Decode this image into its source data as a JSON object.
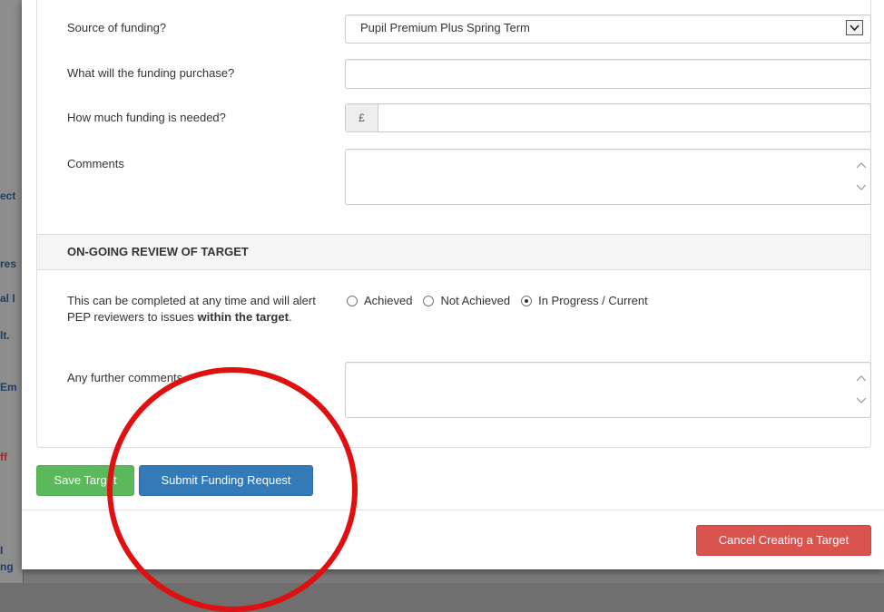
{
  "background": {
    "sidebar_fragments": [
      "ect",
      "res",
      "al I",
      "lt.",
      "Em",
      "ff",
      "I",
      "ng"
    ]
  },
  "form": {
    "source_of_funding": {
      "label": "Source of funding?",
      "selected": "Pupil Premium Plus Spring Term"
    },
    "funding_purchase": {
      "label": "What will the funding purchase?",
      "value": ""
    },
    "funding_needed": {
      "label": "How much funding is needed?",
      "currency_symbol": "£",
      "value": ""
    },
    "comments": {
      "label": "Comments",
      "value": ""
    }
  },
  "review": {
    "header": "ON-GOING REVIEW OF TARGET",
    "description_prefix": "This can be completed at any time and will alert PEP reviewers to issues ",
    "description_bold": "within the target",
    "description_suffix": ".",
    "options": [
      {
        "label": "Achieved",
        "checked": false
      },
      {
        "label": "Not Achieved",
        "checked": false
      },
      {
        "label": "In Progress / Current",
        "checked": true
      }
    ],
    "further_comments": {
      "label": "Any further comments",
      "value": ""
    }
  },
  "buttons": {
    "save": "Save Target",
    "submit": "Submit Funding Request",
    "cancel": "Cancel Creating a Target"
  },
  "colors": {
    "save": "#5cb85c",
    "submit": "#337ab7",
    "cancel": "#d9534f",
    "annotation": "#e01010"
  },
  "icons": {
    "select_arrow": "chevron-down-icon",
    "scroll_up": "chevron-up-icon",
    "scroll_down": "chevron-down-icon"
  }
}
